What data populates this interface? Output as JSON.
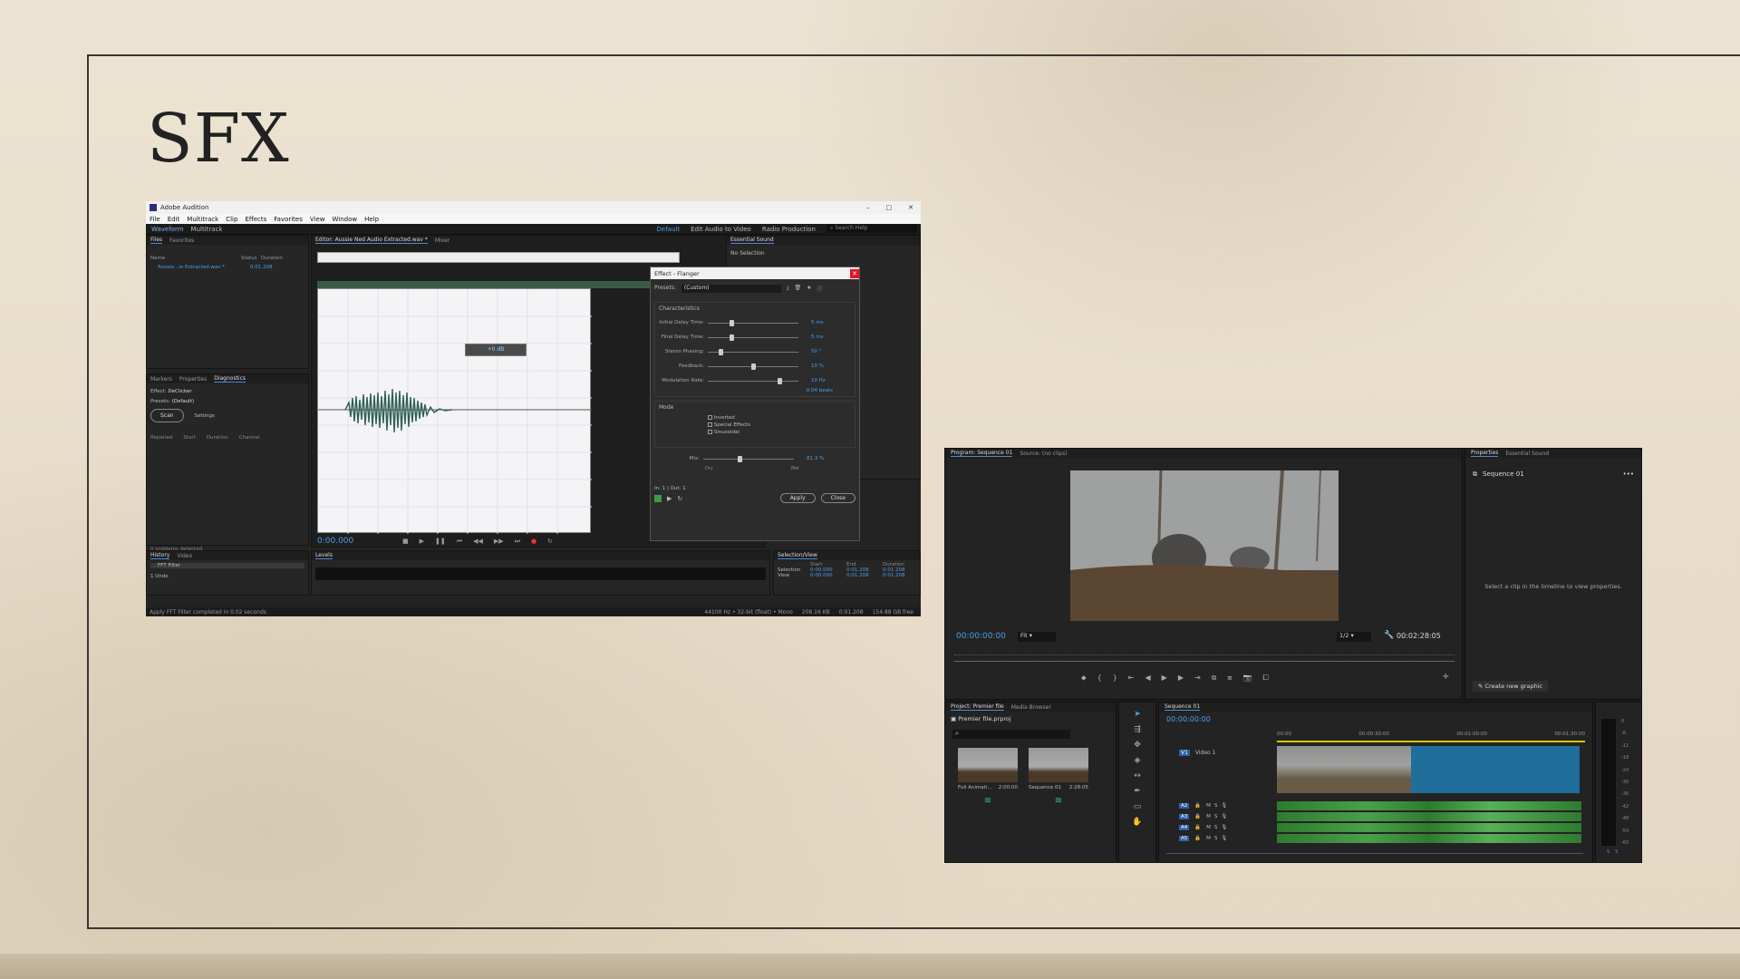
{
  "slide": {
    "title": "SFX"
  },
  "audition": {
    "app_title": "Adobe Audition",
    "menu": [
      "File",
      "Edit",
      "Multitrack",
      "Clip",
      "Effects",
      "Favorites",
      "View",
      "Window",
      "Help"
    ],
    "workspace_tabs": [
      "Waveform",
      "Multitrack"
    ],
    "workspaces": [
      "Default",
      "Edit Audio to Video",
      "Radio Production"
    ],
    "search_placeholder": "Search Help",
    "files_tabs": [
      "Files",
      "Favorites"
    ],
    "files_columns": [
      "Name",
      "Status",
      "Duration"
    ],
    "file_row": {
      "name": "Aussie…io Extracted.wav *",
      "duration": "0:01.208"
    },
    "lower_tabs": [
      "Markers",
      "Properties",
      "Diagnostics"
    ],
    "effect_label": "Effect:",
    "effect_value": "DeClicker",
    "presets_label": "Presets:",
    "presets_value": "(Default)",
    "scan_btn": "Scan",
    "settings_btn": "Settings",
    "diag_columns": [
      "Repaired",
      "Start",
      "Duration",
      "Channel"
    ],
    "problems": "0 problems detected.",
    "history_tabs": [
      "History",
      "Video"
    ],
    "history_item": "FFT Filter",
    "undo": "1 Undo",
    "status_left": "Apply FFT Filter completed in 0.02 seconds",
    "status_right": [
      "44100 Hz • 32-bit (float) • Mono",
      "208.16 KB",
      "0:01.208",
      "154.88 GB free"
    ],
    "editor_tabs": [
      "Editor: Aussie Ned Audio Extracted.wav *",
      "Mixer"
    ],
    "timecode": "0:00.000",
    "hud": "+0 dB",
    "essential_title": "Essential Sound",
    "no_selection": "No Selection",
    "levels_title": "Levels",
    "selview": {
      "title": "Selection/View",
      "cols": [
        "Start",
        "End",
        "Duration"
      ],
      "rows": [
        {
          "label": "Selection",
          "start": "0:00.000",
          "end": "0:01.208",
          "dur": "0:01.208"
        },
        {
          "label": "View",
          "start": "0:00.000",
          "end": "0:01.208",
          "dur": "0:01.208"
        }
      ]
    },
    "flanger": {
      "title": "Effect - Flanger",
      "presets_label": "Presets:",
      "presets_value": "(Custom)",
      "section": "Characteristics",
      "rows": [
        {
          "label": "Initial Delay Time:",
          "value": "5 ms",
          "pos": 0.25
        },
        {
          "label": "Final Delay Time:",
          "value": "5 ms",
          "pos": 0.25
        },
        {
          "label": "Stereo Phasing:",
          "value": "50 °",
          "pos": 0.12
        },
        {
          "label": "Feedback:",
          "value": "10 %",
          "pos": 0.5
        },
        {
          "label": "Modulation Rate:",
          "value": "10 Hz",
          "pos": 0.8
        }
      ],
      "beats": "0.04 beats",
      "mode_title": "Mode",
      "modes": [
        "Inverted",
        "Special Effects",
        "Sinusoidal"
      ],
      "mix_label": "Mix:",
      "mix_value": "81.3 %",
      "mix_left": "Dry",
      "mix_right": "Wet",
      "mix_pos": 0.4,
      "channel": "In: 1 | Out: 1",
      "apply": "Apply",
      "close": "Close"
    }
  },
  "premiere": {
    "program_tab": "Program: Sequence 01",
    "source_tab": "Source: (no clips)",
    "timecode_left": "00:00:00:00",
    "fit": "Fit",
    "res": "1/2",
    "timecode_right": "00:02:28:05",
    "props_tabs": [
      "Properties",
      "Essential Sound"
    ],
    "sequence": "Sequence 01",
    "props_msg": "Select a clip in the timeline to view properties.",
    "create_graphic": "Create new graphic",
    "project_tabs": [
      "Project: Premier file",
      "Media Browser"
    ],
    "project_file": "Premier file.prproj",
    "bins": [
      {
        "name": "Full Animati...",
        "dur": "2:00:00"
      },
      {
        "name": "Sequence 01",
        "dur": "2:28:05"
      }
    ],
    "timeline_tab": "Sequence 01",
    "tl_timecode": "00:00:00:00",
    "ruler": [
      "00:00",
      "00:00:30:00",
      "00:01:00:00",
      "00:01:30:00"
    ],
    "video_track": "V1",
    "video_name": "Video 1",
    "audio_tracks": [
      "A2",
      "A3",
      "A4",
      "A5"
    ],
    "meter_scale": [
      "0",
      "-6",
      "-12",
      "-18",
      "-24",
      "-30",
      "-36",
      "-42",
      "-48",
      "-54",
      "-60"
    ],
    "meter_bottom": [
      "S",
      "S"
    ]
  }
}
